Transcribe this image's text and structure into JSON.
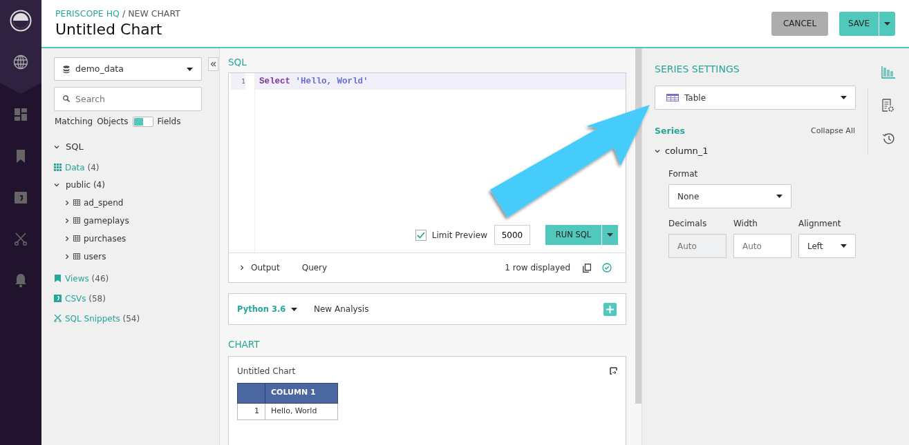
{
  "sidebar": {
    "items": [
      {
        "kind": "globe",
        "selected": true
      },
      {
        "kind": "dashboard",
        "selected": false
      },
      {
        "kind": "bookmark",
        "selected": false
      },
      {
        "kind": "csv",
        "selected": false
      },
      {
        "kind": "scissors",
        "selected": false
      },
      {
        "kind": "bell",
        "selected": false
      }
    ]
  },
  "header": {
    "breadcrumb_root": "PERISCOPE HQ",
    "breadcrumb_current": "/ NEW CHART",
    "title": "Untitled Chart",
    "buttons": [
      {
        "label": "CANCEL",
        "kind": "secondary"
      },
      {
        "label": "SAVE",
        "kind": "primary"
      }
    ]
  },
  "schema_panel": {
    "database": "demo_data",
    "search_placeholder": "Search",
    "matching_label": "Matching",
    "toggle": {
      "left_label": "Objects",
      "right_label": "Fields",
      "on": false
    },
    "tree": {
      "label": "SQL",
      "kind": "section",
      "expanded": true,
      "children": [
        {
          "kind": "data",
          "label": "Data",
          "count": "(4)",
          "children": [
            {
              "kind": "schema",
              "label": "public",
              "count": "(4)",
              "expanded": true,
              "children": [
                {
                  "kind": "table",
                  "label": "ad_spend",
                  "expanded": false
                },
                {
                  "kind": "table",
                  "label": "gameplays",
                  "expanded": false
                },
                {
                  "kind": "table",
                  "label": "purchases",
                  "expanded": false
                },
                {
                  "kind": "table",
                  "label": "users",
                  "expanded": false
                }
              ]
            }
          ]
        },
        {
          "kind": "views",
          "label": "Views",
          "count": "(46)"
        },
        {
          "kind": "csvs",
          "label": "CSVs",
          "count": "(58)"
        },
        {
          "kind": "snippets",
          "label": "SQL Snippets",
          "count": "(54)"
        }
      ]
    }
  },
  "editor": {
    "section_title": "SQL",
    "lines": [
      {
        "number": "1",
        "tokens": [
          {
            "kind": "keyword",
            "text": "Select"
          },
          {
            "kind": "string",
            "text": "'Hello, World'"
          }
        ]
      }
    ],
    "limit_preview": {
      "label": "Limit Preview",
      "checked": true,
      "value": "5000"
    },
    "run_button": "RUN SQL",
    "result_tabs": [
      {
        "label": "Output",
        "expanded": false
      },
      {
        "label": "Query"
      }
    ],
    "status": "1 row displayed"
  },
  "analysis": {
    "language": "Python 3.6",
    "name": "New Analysis"
  },
  "chart": {
    "section_title": "CHART",
    "title": "Untitled Chart",
    "table": {
      "columns": [
        "COLUMN 1"
      ],
      "rows": [
        {
          "index": "1",
          "cells": [
            "Hello, World"
          ]
        }
      ]
    }
  },
  "series_settings": {
    "title": "SERIES SETTINGS",
    "chart_type": "Table",
    "series_label": "Series",
    "collapse_all": "Collapse All",
    "series": [
      {
        "name": "column_1",
        "expanded": true,
        "format_label": "Format",
        "format": "None",
        "decimals_label": "Decimals",
        "decimals_placeholder": "Auto",
        "decimals_disabled": true,
        "width_label": "Width",
        "width_placeholder": "Auto",
        "alignment_label": "Alignment",
        "alignment": "Left"
      }
    ]
  },
  "right_tabs": [
    {
      "kind": "chart",
      "selected": true
    },
    {
      "kind": "settings",
      "selected": false
    },
    {
      "kind": "history",
      "selected": false
    }
  ]
}
